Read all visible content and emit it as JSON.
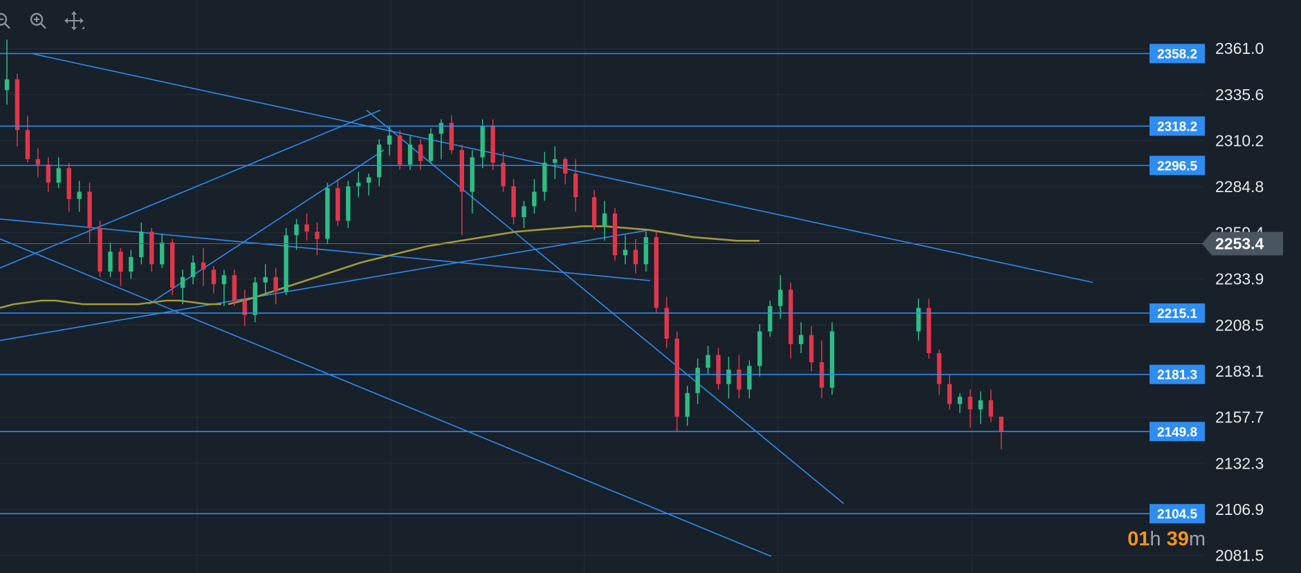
{
  "toolbar": {
    "tools": [
      {
        "name": "zoom-out-icon"
      },
      {
        "name": "zoom-in-icon"
      },
      {
        "name": "move-crosshair-icon"
      }
    ]
  },
  "colors": {
    "background": "#18202a",
    "grid": "#262f3a",
    "up_candle": "#2ebd85",
    "down_candle": "#e0364b",
    "trendline": "#2f8cf0",
    "moving_average": "#a39a3a",
    "axis_text": "#e6e8ea",
    "price_tag_text": "#ffffff",
    "current_price_tag": "#4a5562",
    "countdown_number": "#f7931a"
  },
  "chart_data": {
    "type": "candlestick",
    "y_axis": {
      "range": [
        2076,
        2366
      ],
      "ticks": [
        2361.0,
        2335.6,
        2310.2,
        2284.8,
        2259.4,
        2233.9,
        2208.5,
        2183.1,
        2157.7,
        2132.3,
        2106.9,
        2081.5
      ]
    },
    "current_price": "2253.4",
    "horizontal_levels": [
      "2358.2",
      "2318.2",
      "2296.5",
      "2215.1",
      "2181.3",
      "2149.8",
      "2104.5"
    ],
    "candle_count": 89,
    "candles": [
      [
        2338,
        2366,
        2330,
        2344
      ],
      [
        2344,
        2347,
        2307,
        2316
      ],
      [
        2316,
        2324,
        2298,
        2300
      ],
      [
        2300,
        2306,
        2290,
        2297
      ],
      [
        2297,
        2301,
        2282,
        2287
      ],
      [
        2287,
        2301,
        2284,
        2295
      ],
      [
        2295,
        2298,
        2271,
        2278
      ],
      [
        2278,
        2288,
        2271,
        2282
      ],
      [
        2282,
        2287,
        2254,
        2262
      ],
      [
        2262,
        2266,
        2235,
        2238
      ],
      [
        2238,
        2254,
        2235,
        2249
      ],
      [
        2249,
        2251,
        2230,
        2238
      ],
      [
        2238,
        2250,
        2234,
        2246
      ],
      [
        2246,
        2265,
        2242,
        2260
      ],
      [
        2260,
        2262,
        2238,
        2242
      ],
      [
        2242,
        2259,
        2240,
        2254
      ],
      [
        2254,
        2256,
        2225,
        2229
      ],
      [
        2229,
        2239,
        2220,
        2235
      ],
      [
        2235,
        2247,
        2231,
        2243
      ],
      [
        2243,
        2251,
        2230,
        2239
      ],
      [
        2239,
        2241,
        2226,
        2231
      ],
      [
        2231,
        2239,
        2219,
        2236
      ],
      [
        2236,
        2239,
        2219,
        2222
      ],
      [
        2222,
        2228,
        2208,
        2214
      ],
      [
        2214,
        2235,
        2210,
        2232
      ],
      [
        2232,
        2242,
        2225,
        2235
      ],
      [
        2235,
        2240,
        2220,
        2227
      ],
      [
        2227,
        2262,
        2225,
        2258
      ],
      [
        2258,
        2267,
        2250,
        2264
      ],
      [
        2264,
        2270,
        2255,
        2260
      ],
      [
        2260,
        2265,
        2247,
        2256
      ],
      [
        2256,
        2287,
        2253,
        2284
      ],
      [
        2284,
        2289,
        2263,
        2266
      ],
      [
        2266,
        2288,
        2262,
        2285
      ],
      [
        2285,
        2293,
        2279,
        2287
      ],
      [
        2287,
        2292,
        2280,
        2290
      ],
      [
        2290,
        2311,
        2285,
        2308
      ],
      [
        2308,
        2318,
        2302,
        2313
      ],
      [
        2313,
        2316,
        2294,
        2297
      ],
      [
        2297,
        2313,
        2294,
        2308
      ],
      [
        2308,
        2311,
        2294,
        2299
      ],
      [
        2299,
        2317,
        2298,
        2314
      ],
      [
        2314,
        2322,
        2300,
        2320
      ],
      [
        2320,
        2324,
        2303,
        2305
      ],
      [
        2305,
        2308,
        2258,
        2282
      ],
      [
        2282,
        2305,
        2270,
        2301
      ],
      [
        2301,
        2322,
        2295,
        2318
      ],
      [
        2318,
        2322,
        2294,
        2298
      ],
      [
        2298,
        2304,
        2282,
        2285
      ],
      [
        2285,
        2289,
        2264,
        2268
      ],
      [
        2268,
        2277,
        2262,
        2274
      ],
      [
        2274,
        2289,
        2270,
        2282
      ],
      [
        2282,
        2304,
        2277,
        2298
      ],
      [
        2298,
        2307,
        2289,
        2300
      ],
      [
        2300,
        2301,
        2286,
        2292
      ],
      [
        2292,
        2300,
        2271,
        2279
      ],
      [
        2279,
        2283,
        2261,
        2263
      ],
      [
        2263,
        2277,
        2255,
        2270
      ],
      [
        2270,
        2273,
        2244,
        2247
      ],
      [
        2247,
        2258,
        2242,
        2250
      ],
      [
        2250,
        2256,
        2237,
        2242
      ],
      [
        2242,
        2260,
        2238,
        2257
      ],
      [
        2257,
        2260,
        2215,
        2218
      ],
      [
        2218,
        2224,
        2196,
        2201
      ],
      [
        2201,
        2205,
        2150,
        2158
      ],
      [
        2158,
        2175,
        2153,
        2171
      ],
      [
        2171,
        2190,
        2165,
        2185
      ],
      [
        2185,
        2197,
        2181,
        2192
      ],
      [
        2192,
        2196,
        2173,
        2176
      ],
      [
        2176,
        2191,
        2168,
        2184
      ],
      [
        2184,
        2192,
        2168,
        2173
      ],
      [
        2173,
        2189,
        2168,
        2186
      ],
      [
        2186,
        2209,
        2180,
        2205
      ],
      [
        2205,
        2222,
        2202,
        2219
      ],
      [
        2219,
        2236,
        2212,
        2228
      ],
      [
        2228,
        2232,
        2190,
        2198
      ],
      [
        2198,
        2210,
        2193,
        2203
      ],
      [
        2203,
        2208,
        2183,
        2188
      ],
      [
        2188,
        2200,
        2168,
        2174
      ],
      [
        2174,
        2210,
        2170,
        2205
      ],
      [
        2205,
        2223,
        2200,
        2218
      ],
      [
        2218,
        2223,
        2190,
        2193
      ],
      [
        2193,
        2195,
        2170,
        2176
      ],
      [
        2176,
        2181,
        2162,
        2165
      ],
      [
        2165,
        2171,
        2160,
        2169
      ],
      [
        2169,
        2173,
        2152,
        2162
      ],
      [
        2162,
        2172,
        2154,
        2167
      ],
      [
        2167,
        2173,
        2155,
        2158
      ],
      [
        2158,
        2150,
        2140,
        2150
      ]
    ],
    "moving_average_segments": [
      [
        2218,
        2220,
        2221,
        2222,
        2222,
        2221,
        2220,
        2220,
        2220,
        2220,
        2220,
        2221,
        2222,
        2222,
        2221,
        2220,
        2220
      ],
      [
        2220,
        2223,
        2227,
        2231,
        2235,
        2239,
        2243,
        2246,
        2249,
        2252,
        2254,
        2256,
        2258,
        2260,
        2261,
        2262,
        2263,
        2263,
        2262,
        2261,
        2259,
        2257,
        2256,
        2255,
        2255
      ]
    ],
    "trendlines": 7,
    "countdown": {
      "hours": "01",
      "hours_unit": "h",
      "minutes": "39",
      "minutes_unit": "m"
    }
  }
}
